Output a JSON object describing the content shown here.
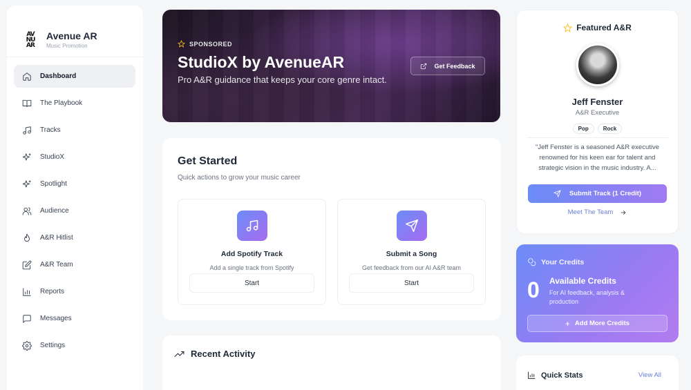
{
  "brand": {
    "name": "Avenue AR",
    "tagline": "Music Promotion",
    "logo_letters": [
      "AV",
      "NU",
      "AR"
    ]
  },
  "sidebar": {
    "items": [
      {
        "label": "Dashboard",
        "icon": "home-icon",
        "active": true
      },
      {
        "label": "The Playbook",
        "icon": "book-icon"
      },
      {
        "label": "Tracks",
        "icon": "music-note-icon"
      },
      {
        "label": "StudioX",
        "icon": "sparkles-icon"
      },
      {
        "label": "Spotlight",
        "icon": "sparkles-icon"
      },
      {
        "label": "Audience",
        "icon": "users-icon"
      },
      {
        "label": "A&R Hitlist",
        "icon": "flame-icon"
      },
      {
        "label": "A&R Team",
        "icon": "edit-icon"
      },
      {
        "label": "Reports",
        "icon": "bar-chart-icon"
      },
      {
        "label": "Messages",
        "icon": "message-icon"
      },
      {
        "label": "Settings",
        "icon": "gear-icon"
      }
    ]
  },
  "hero": {
    "badge": "SPONSORED",
    "title": "StudioX by AvenueAR",
    "subtitle": "Pro A&R guidance that keeps your core genre intact.",
    "button": "Get Feedback"
  },
  "get_started": {
    "title": "Get Started",
    "subtitle": "Quick actions to grow your music career",
    "actions": [
      {
        "title": "Add Spotify Track",
        "desc": "Add a single track from Spotify",
        "button": "Start",
        "icon": "music-note-icon"
      },
      {
        "title": "Submit a Song",
        "desc": "Get feedback from our AI A&R team",
        "button": "Start",
        "icon": "send-icon"
      }
    ]
  },
  "recent_activity": {
    "title": "Recent Activity"
  },
  "featured": {
    "title": "Featured A&R",
    "name": "Jeff Fenster",
    "role": "A&R Executive",
    "tags": [
      "Pop",
      "Rock"
    ],
    "quote": "\"Jeff Fenster is a seasoned A&R executive renowned for his keen ear for talent and strategic vision in the music industry. A...",
    "submit_button": "Submit Track (1 Credit)",
    "meet_link": "Meet The Team"
  },
  "credits": {
    "title": "Your Credits",
    "count": "0",
    "label": "Available Credits",
    "desc": "For AI feedback, analysis & production",
    "button": "Add More Credits"
  },
  "quick_stats": {
    "title": "Quick Stats",
    "view_all": "View All"
  },
  "colors": {
    "accent_start": "#6b8cf7",
    "accent_end": "#a86cf0",
    "link": "#6b7fd8",
    "star": "#fbbf24"
  }
}
